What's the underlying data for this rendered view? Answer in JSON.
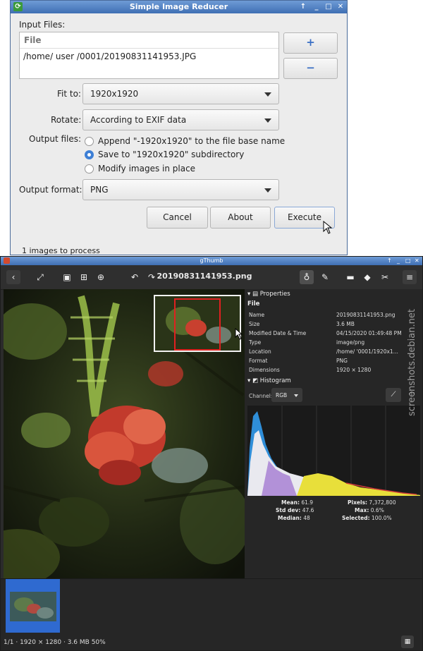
{
  "reducer": {
    "title": "Simple Image Reducer",
    "input_files_label": "Input Files:",
    "file_column": "File",
    "files": [
      "/home/  user  /0001/20190831141953.JPG"
    ],
    "add_button": "+",
    "remove_button": "−",
    "fit_to_label": "Fit to:",
    "fit_to_value": "1920x1920",
    "rotate_label": "Rotate:",
    "rotate_value": "According to EXIF data",
    "output_files_label": "Output files:",
    "output_options": [
      "Append \"-1920x1920\" to the file base name",
      "Save to \"1920x1920\" subdirectory",
      "Modify images in place"
    ],
    "output_selected_index": 1,
    "output_format_label": "Output format:",
    "output_format_value": "PNG",
    "cancel_label": "Cancel",
    "about_label": "About",
    "execute_label": "Execute",
    "status": "1 images to process"
  },
  "gthumb": {
    "title": "gThumb",
    "filename": "20190831141953.png",
    "properties_title": "Properties",
    "file_section": "File",
    "properties": [
      {
        "key": "Name",
        "value": "20190831141953.png"
      },
      {
        "key": "Size",
        "value": "3.6 MB"
      },
      {
        "key": "Modified Date & Time",
        "value": "04/15/2020 01:49:48 PM"
      },
      {
        "key": "Type",
        "value": "image/png"
      },
      {
        "key": "Location",
        "value": "/home/          '0001/1920x1..."
      },
      {
        "key": "Format",
        "value": "PNG"
      },
      {
        "key": "Dimensions",
        "value": "1920 × 1280"
      }
    ],
    "histogram_title": "Histogram",
    "channel_label": "Channel:",
    "channel_value": "RGB",
    "stats": {
      "mean_label": "Mean:",
      "mean": "61.9",
      "stddev_label": "Std dev:",
      "stddev": "47.6",
      "median_label": "Median:",
      "median": "48",
      "pixels_label": "Pixels:",
      "pixels": "7,372,800",
      "max_label": "Max:",
      "max": "0.6%",
      "selected_label": "Selected:",
      "selected": "100.0%"
    },
    "status": "1/1  ·  1920 × 1280  ·  3.6 MB     50%"
  },
  "watermark": "screenshots.debian.net",
  "colors": {
    "titlebar": "#4f80c4",
    "accent": "#3d7fd6",
    "dark_bg": "#262626"
  }
}
